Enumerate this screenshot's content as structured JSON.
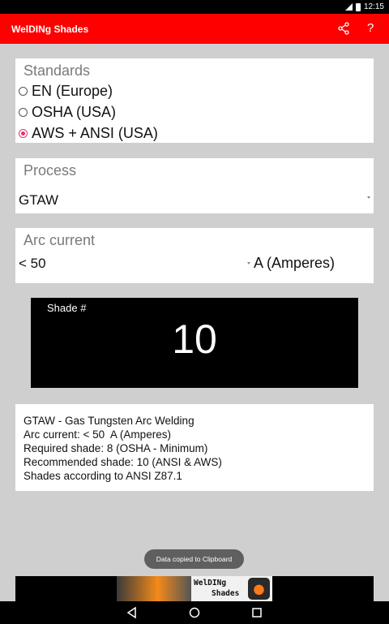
{
  "status_bar": {
    "time": "12:15",
    "icons": [
      "signal-icon",
      "battery-icon"
    ]
  },
  "app_bar": {
    "title": "WelDINg Shades",
    "actions": [
      "share-icon",
      "help-icon"
    ],
    "help_label": "?"
  },
  "standards": {
    "title": "Standards",
    "options": [
      {
        "label": "EN (Europe)",
        "selected": false
      },
      {
        "label": "OSHA (USA)",
        "selected": false
      },
      {
        "label": "AWS + ANSI (USA)",
        "selected": true
      }
    ]
  },
  "process": {
    "title": "Process",
    "value": "GTAW"
  },
  "arc_current": {
    "title": "Arc current",
    "value": "< 50",
    "unit": "A (Amperes)"
  },
  "shade": {
    "label": "Shade #",
    "value": "10"
  },
  "info": {
    "lines": [
      "GTAW - Gas Tungsten Arc Welding",
      "Arc current: < 50  A (Amperes)",
      "Required shade: 8 (OSHA - Minimum)",
      "Recommended shade: 10 (ANSI & AWS)",
      "Shades according to ANSI Z87.1"
    ]
  },
  "toast": "Data copied to Clipboard",
  "ad": {
    "line1": "WelDINg",
    "line2": "Shades"
  },
  "colors": {
    "app_bar": "#ff0000",
    "accent": "#e0336a",
    "background": "#cfcfcf",
    "shade_box": "#000000"
  },
  "nav_bar": {
    "buttons": [
      "back-icon",
      "home-icon",
      "recents-icon"
    ]
  }
}
